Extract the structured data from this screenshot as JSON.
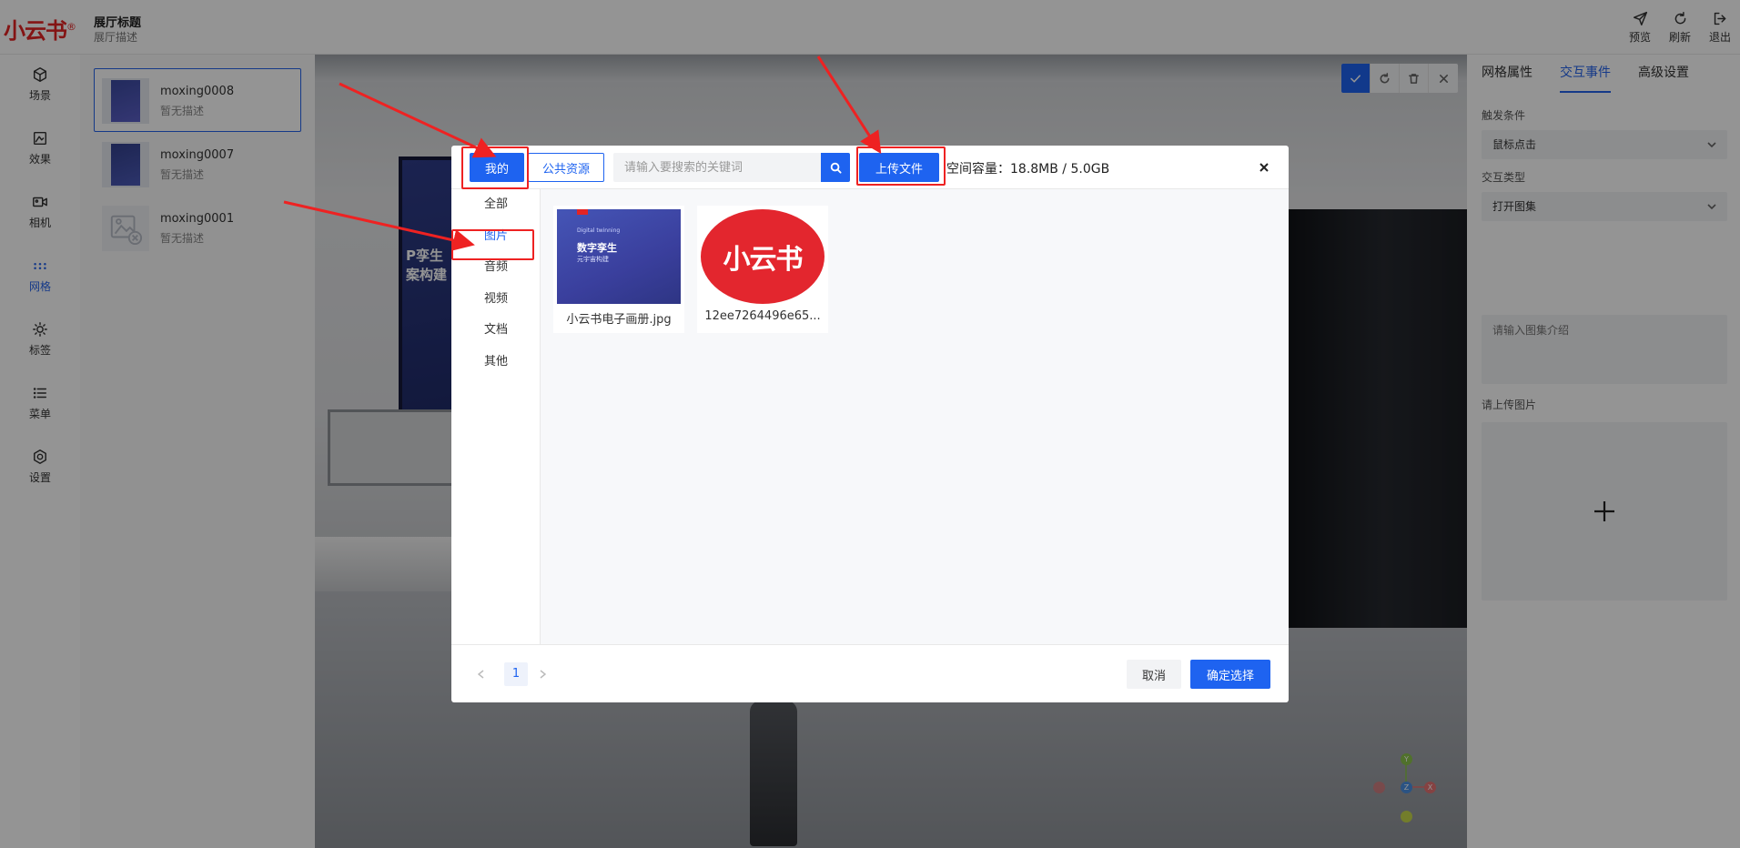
{
  "app": {
    "logo_text": "小云书",
    "logo_mark": "®",
    "hall_title": "展厅标题",
    "hall_desc": "展厅描述"
  },
  "top_actions": [
    {
      "label": "预览",
      "icon": "send-icon"
    },
    {
      "label": "刷新",
      "icon": "refresh-icon"
    },
    {
      "label": "退出",
      "icon": "logout-icon"
    }
  ],
  "nav": [
    {
      "label": "场景",
      "icon": "cube-icon"
    },
    {
      "label": "效果",
      "icon": "image-effect-icon"
    },
    {
      "label": "相机",
      "icon": "camera-icon"
    },
    {
      "label": "网格",
      "icon": "grid-dots-icon",
      "active": true
    },
    {
      "label": "标签",
      "icon": "tag-sun-icon"
    },
    {
      "label": "菜单",
      "icon": "menu-list-icon"
    },
    {
      "label": "设置",
      "icon": "gear-icon"
    }
  ],
  "models": [
    {
      "name": "moxing0008",
      "desc": "暂无描述",
      "selected": true
    },
    {
      "name": "moxing0007",
      "desc": "暂无描述"
    },
    {
      "name": "moxing0001",
      "desc": "暂无描述"
    }
  ],
  "scene": {
    "poster_text": "Р孪生\n案构建"
  },
  "right_panel": {
    "tabs": [
      "网格属性",
      "交互事件",
      "高级设置"
    ],
    "active_tab": "交互事件",
    "trigger_label": "触发条件",
    "trigger_value": "鼠标点击",
    "type_label": "交互类型",
    "type_value": "打开图集",
    "intro_placeholder": "请输入图集介绍",
    "upload_label": "请上传图片"
  },
  "modal": {
    "tab_mine": "我的",
    "tab_public": "公共资源",
    "search_placeholder": "请输入要搜索的关键词",
    "upload_button": "上传文件",
    "storage": "空间容量：18.8MB / 5.0GB",
    "categories": [
      "全部",
      "图片",
      "音频",
      "视频",
      "文档",
      "其他"
    ],
    "active_category": "图片",
    "files": [
      {
        "name": "小云书电子画册.jpg",
        "cover_line1": "Digital twinning",
        "cover_line2": "数字孪生",
        "cover_line3": "元宇宙构建"
      },
      {
        "name": "12ee7264496e65...",
        "logo_text": "小云书"
      }
    ],
    "page": "1",
    "cancel": "取消",
    "confirm": "确定选择"
  },
  "colors": {
    "primary": "#1e63f0",
    "highlight": "#ee2222",
    "brand_red": "#e3262e"
  }
}
